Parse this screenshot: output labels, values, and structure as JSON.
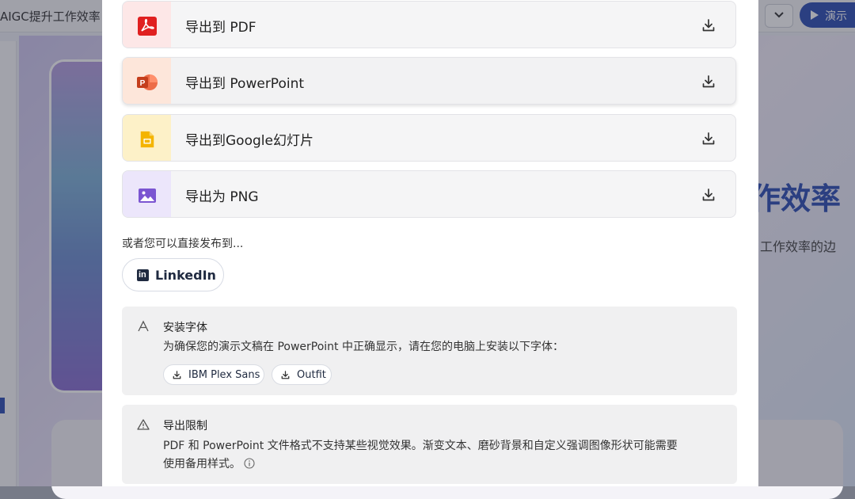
{
  "background": {
    "doc_title": "AIGC提升工作效率",
    "present_button": "演示",
    "slide_heading": "作效率",
    "slide_subtitle": "工作效率的边"
  },
  "export_options": [
    {
      "label": "导出到 PDF",
      "icon": "pdf-icon",
      "tile_color": "#fde7e7",
      "icon_color": "#e02020"
    },
    {
      "label": "导出到 PowerPoint",
      "icon": "powerpoint-icon",
      "tile_color": "#fde6da",
      "icon_color": "#d24726"
    },
    {
      "label": "导出到Google幻灯片",
      "icon": "google-slides-icon",
      "tile_color": "#fdf1c8",
      "icon_color": "#f4b400"
    },
    {
      "label": "导出为 PNG",
      "icon": "image-icon",
      "tile_color": "#ece6fb",
      "icon_color": "#7b55d1"
    }
  ],
  "publish": {
    "text": "或者您可以直接发布到...",
    "linkedin_label": "LinkedIn"
  },
  "install_fonts": {
    "title": "安装字体",
    "body": "为确保您的演示文稿在 PowerPoint 中正确显示，请在您的电脑上安装以下字体：",
    "fonts": [
      "IBM Plex Sans",
      "Outfit"
    ]
  },
  "export_limits": {
    "title": "导出限制",
    "body_line1": "PDF 和 PowerPoint 文件格式不支持某些视觉效果。渐变文本、磨砂背景和自定义强调图像形状可能需要",
    "body_line2": "使用备用样式。"
  }
}
